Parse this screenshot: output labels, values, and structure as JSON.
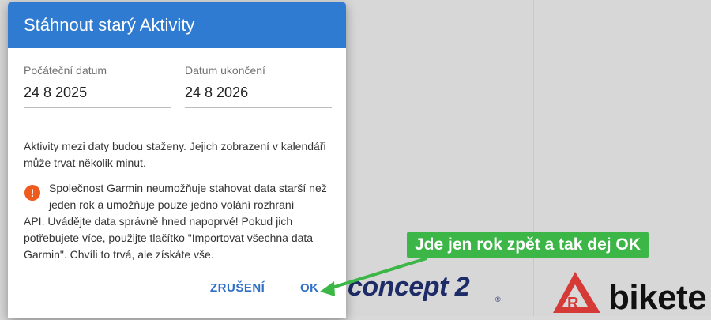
{
  "dialog": {
    "title": "Stáhnout starý Aktivity",
    "start_label": "Počáteční datum",
    "start_value": "24 8 2025",
    "end_label": "Datum ukončení",
    "end_value": "24 8 2026",
    "info_text": "Aktivity mezi daty budou staženy. Jejich zobrazení v kalendáři může trvat několik minut.",
    "warning_line1": "Společnost Garmin neumožňuje stahovat data starší než jeden rok a umožňuje pouze jedno volání rozhraní",
    "warning_rest": "API. Uvádějte data správně hned napoprvé! Pokud jich potřebujete více, použijte tlačítko \"Importovat všechna data Garmin\". Chvíli to trvá, ale získáte vše.",
    "warning_icon": "!",
    "cancel_label": "ZRUŠENÍ",
    "ok_label": "OK"
  },
  "annotation": {
    "text": "Jde jen rok zpět a tak dej OK"
  },
  "logos": {
    "concept2": "concept 2",
    "concept2_reg": "®",
    "bike": "bikete"
  },
  "colors": {
    "header": "#2f7bd1",
    "button_text": "#2f6fc8",
    "warning": "#ef5a1e",
    "annotation": "#3db648"
  }
}
